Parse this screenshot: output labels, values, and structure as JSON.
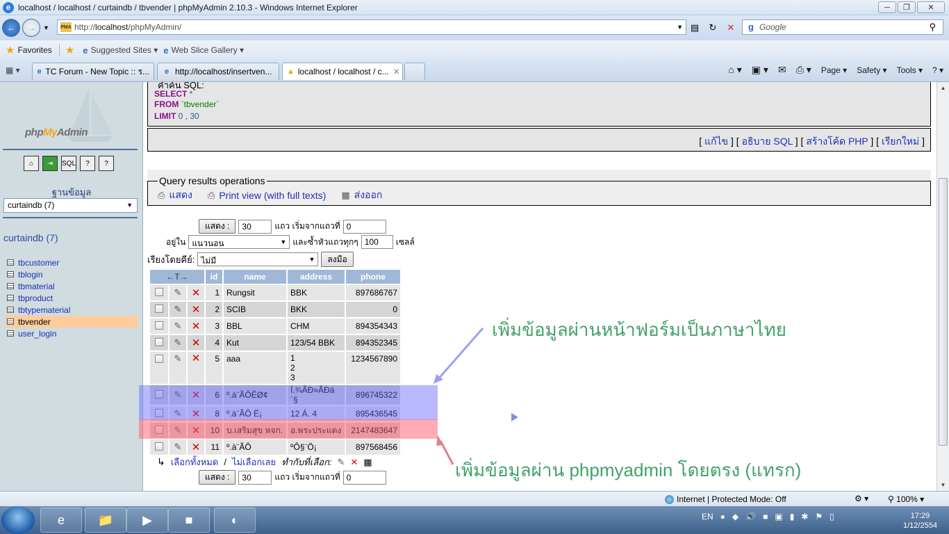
{
  "window": {
    "title": "localhost / localhost / curtaindb / tbvender | phpMyAdmin 2.10.3 - Windows Internet Explorer",
    "buttons": [
      "minimize",
      "restore",
      "close"
    ]
  },
  "addressbar": {
    "url_prefix": "http://",
    "url_host": "localhost",
    "url_path": "/phpMyAdmin/",
    "search_placeholder": "Google"
  },
  "favorites": {
    "label": "Favorites",
    "items": [
      "Suggested Sites ▾",
      "Web Slice Gallery ▾"
    ]
  },
  "tabs": [
    {
      "label": "TC Forum - New Topic :: ร...",
      "active": false
    },
    {
      "label": "http://localhost/insertven...",
      "active": false
    },
    {
      "label": "localhost / localhost / c...",
      "active": true
    }
  ],
  "commandbar": {
    "page": "Page ▾",
    "safety": "Safety ▾",
    "tools": "Tools ▾",
    "help": "? ▾"
  },
  "sidebar": {
    "logo_php": "php",
    "logo_my": "My",
    "logo_admin": "Admin",
    "db_label": "ฐานข้อมูล",
    "db_select": "curtaindb (7)",
    "db_name": "curtaindb (7)",
    "tables": [
      {
        "name": "tbcustomer",
        "selected": false
      },
      {
        "name": "tblogin",
        "selected": false
      },
      {
        "name": "tbmaterial",
        "selected": false
      },
      {
        "name": "tbproduct",
        "selected": false
      },
      {
        "name": "tbtypematerial",
        "selected": false
      },
      {
        "name": "tbvender",
        "selected": true
      },
      {
        "name": "user_login",
        "selected": false
      }
    ]
  },
  "sql": {
    "caption": "คำค้น SQL:",
    "line1_kw": "SELECT",
    "line1_rest": " *",
    "line2_kw": "FROM",
    "line2_rest": " `tbvender`",
    "line3_kw": "LIMIT",
    "line3_rest": " 0 , 30",
    "links": [
      "แก้ไข",
      "อธิบาย SQL",
      "สร้างโค้ด PHP",
      "เรียกใหม่"
    ]
  },
  "qro": {
    "legend": "Query results operations",
    "ops": [
      {
        "icon": "print-icon",
        "label": "แสดง"
      },
      {
        "icon": "print-icon",
        "label": "Print view (with full texts)"
      },
      {
        "icon": "export-icon",
        "label": "ส่งออก"
      }
    ]
  },
  "nav": {
    "show_btn": "แสดง :",
    "rows": "30",
    "from_label": "แถว เริ่มจากแถวที่",
    "from_value": "0",
    "in_label": "อยู่ใน",
    "mode": "แนวนอน",
    "repeat_label": "และซ้ำหัวแถวทุกๆ",
    "repeat_value": "100",
    "cells_label": "เซลล์",
    "sort_label": "เรียงโดยคีย์:",
    "sort_value": "ไม่มี",
    "go_btn": "ลงมือ"
  },
  "table": {
    "headers": [
      "←T→",
      "id",
      "name",
      "address",
      "phone"
    ],
    "rows": [
      {
        "id": "1",
        "name": "Rungsit",
        "address": [
          "BBK"
        ],
        "phone": "897686767"
      },
      {
        "id": "2",
        "name": "SCIB",
        "address": [
          "BKK"
        ],
        "phone": "0"
      },
      {
        "id": "3",
        "name": "BBL",
        "address": [
          "CHM"
        ],
        "phone": "894354343"
      },
      {
        "id": "4",
        "name": "Kut",
        "address": [
          "123/54 BBK"
        ],
        "phone": "894352345"
      },
      {
        "id": "5",
        "name": "aaa",
        "address": [
          "1",
          "2",
          "3"
        ],
        "phone": "1234567890"
      },
      {
        "id": "6",
        "name": "º.à¨ÃÔÊØ¢",
        "address": [
          "Í.¾ÃÐ»ÃÐá´§"
        ],
        "phone": "896745322"
      },
      {
        "id": "8",
        "name": "º.à¨ÃÔ Ë¡",
        "address": [
          "12 Á. 4"
        ],
        "phone": "895436545"
      },
      {
        "id": "10",
        "name": "บ.เสริมสุข หจก.",
        "address": [
          "อ.พระประแดง"
        ],
        "phone": "2147483647"
      },
      {
        "id": "11",
        "name": "º.à¨ÃÔ",
        "address": [
          "ºÔ§¨Ö¡"
        ],
        "phone": "897568456"
      }
    ]
  },
  "checkall": {
    "check": "เลือกทั้งหมด",
    "slash": " / ",
    "uncheck": "ไม่เลือกเลย",
    "with_selected": "ทำกับที่เลือก:"
  },
  "annotations": {
    "top": "เพิ่มข้อมูลผ่านหน้าฟอร์มเป็นภาษาไทย",
    "bottom": "เพิ่มข้อมูลผ่าน phpmyadmin โดยตรง (แทรก)"
  },
  "statusbar": {
    "zone": "Internet | Protected Mode: Off",
    "zoom": "100%"
  },
  "taskbar": {
    "lang": "EN",
    "time": "17:29",
    "date": "1/12/2554"
  },
  "colors": {
    "highlight_blue": "#6464ff",
    "highlight_red": "#ff5a6e",
    "annotation_green": "#43a16b",
    "selected_table": "#ffcc99"
  }
}
